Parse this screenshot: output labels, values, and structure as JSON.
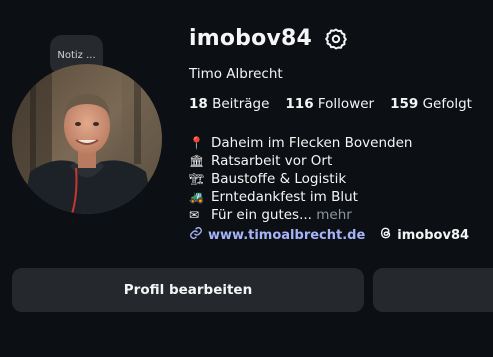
{
  "note": {
    "label": "Notiz ..."
  },
  "profile": {
    "username": "imobov84",
    "full_name": "Timo Albrecht",
    "avatar_icon": "profile-photo"
  },
  "stats": {
    "posts": {
      "count": "18",
      "label": "Beiträge"
    },
    "followers": {
      "count": "116",
      "label": "Follower"
    },
    "following": {
      "count": "159",
      "label": "Gefolgt"
    }
  },
  "bio": {
    "lines": [
      {
        "emoji": "📍",
        "text": "Daheim im Flecken Bovenden"
      },
      {
        "emoji": "🏛",
        "text": "Ratsarbeit vor Ort"
      },
      {
        "emoji": "🏗",
        "text": "Baustoffe & Logistik"
      },
      {
        "emoji": "🚜",
        "text": "Erntedankfest im Blut"
      },
      {
        "emoji": "✉",
        "text": "Für ein gutes..."
      }
    ],
    "more_label": "mehr"
  },
  "links": {
    "website": "www.timoalbrecht.de",
    "threads": "imobov84"
  },
  "buttons": {
    "edit_profile": "Profil bearbeiten"
  },
  "colors": {
    "background": "#0c1014",
    "button": "#25292e",
    "link": "#a6b3f7",
    "muted": "#8e959c"
  }
}
